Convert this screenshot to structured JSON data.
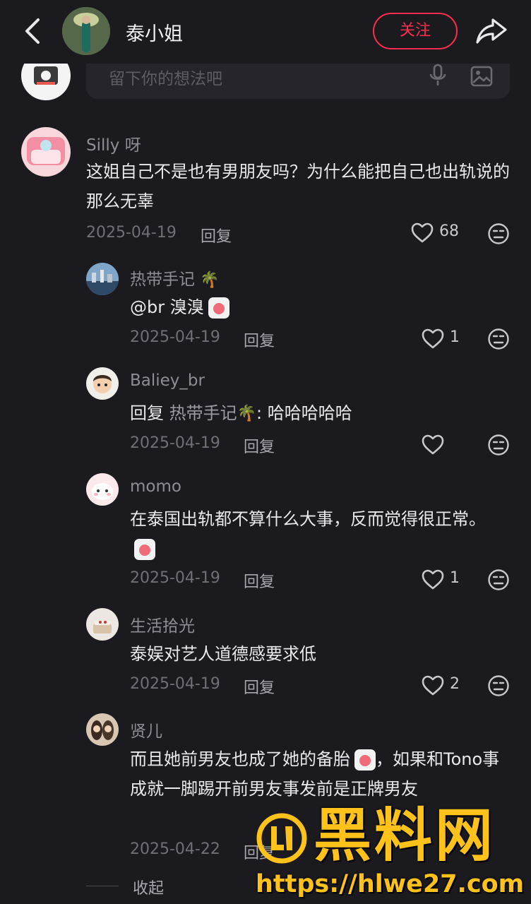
{
  "header": {
    "title": "泰小姐",
    "follow_label": "关注"
  },
  "input": {
    "placeholder": "留下你的想法吧"
  },
  "comments": [
    {
      "name": "Silly 呀",
      "text": "这姐自己不是也有男朋友吗？为什么能把自己也出轨说的那么无辜",
      "date": "2025-04-19",
      "reply_label": "回复",
      "likes": "68"
    },
    {
      "name": "热带手记",
      "text": "@br 溴溴",
      "date": "2025-04-19",
      "reply_label": "回复",
      "likes": "1"
    },
    {
      "name": "Baliey_br",
      "text_prefix": "回复 ",
      "mention": "热带手记",
      "text": ": 哈哈哈哈哈",
      "date": "2025-04-19",
      "reply_label": "回复",
      "likes": ""
    },
    {
      "name": "momo",
      "text": "在泰国出轨都不算什么大事，反而觉得很正常。",
      "date": "2025-04-19",
      "reply_label": "回复",
      "likes": "1"
    },
    {
      "name": "生活拾光",
      "text": "泰娱对艺人道德感要求低",
      "date": "2025-04-19",
      "reply_label": "回复",
      "likes": "2"
    },
    {
      "name": "贤儿",
      "text_a": "而且她前男友也成了她的备胎",
      "text_b": "，如果和Tono事成就一脚踢开前男友事发前是正牌男友",
      "date": "2025-04-22",
      "reply_label": "回复"
    }
  ],
  "collapse_label": "收起",
  "watermark": {
    "title": "黑料网",
    "url": "https://hlwe27.com"
  },
  "colors": {
    "background": "#1a1a1f",
    "accent": "#ff2e4d",
    "watermark": "#ffc21a"
  }
}
